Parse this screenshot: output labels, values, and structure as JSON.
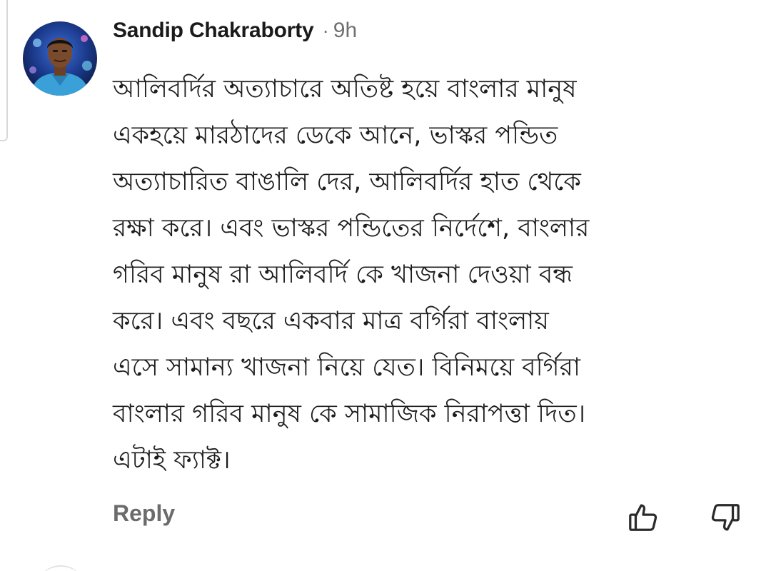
{
  "comment": {
    "author": "Sandip Chakraborty",
    "separator": "·",
    "time": "9h",
    "lines": [
      "আলিবর্দির অত্যাচারে অতিষ্ট হয়ে বাংলার মানুষ",
      "একহয়ে মারঠাদের ডেকে আনে, ভাস্কর পন্ডিত",
      "অত্যাচারিত বাঙালি দের, আলিবর্দির হাত থেকে",
      "রক্ষা করে। এবং ভাস্কর পন্ডিতের নির্দেশে, বাংলার",
      "গরিব মানুষ রা আলিবর্দি কে খাজনা দেওয়া বন্ধ",
      "করে। এবং বছরে একবার মাত্র বর্গিরা বাংলায়",
      "এসে সামান্য খাজনা নিয়ে যেত। বিনিময়ে বর্গিরা",
      "বাংলার গরিব মানুষ কে  সামাজিক নিরাপত্তা দিত।",
      "এটাই ফ্যাক্ট।"
    ],
    "actions": {
      "reply_label": "Reply",
      "like_icon": "thumbs-up-outline",
      "dislike_icon": "thumbs-down-outline"
    }
  },
  "colors": {
    "author": "#1a1a1a",
    "meta": "#707070",
    "body_text": "#1c1c1c",
    "action": "#6b6b6b",
    "background": "#ffffff"
  }
}
